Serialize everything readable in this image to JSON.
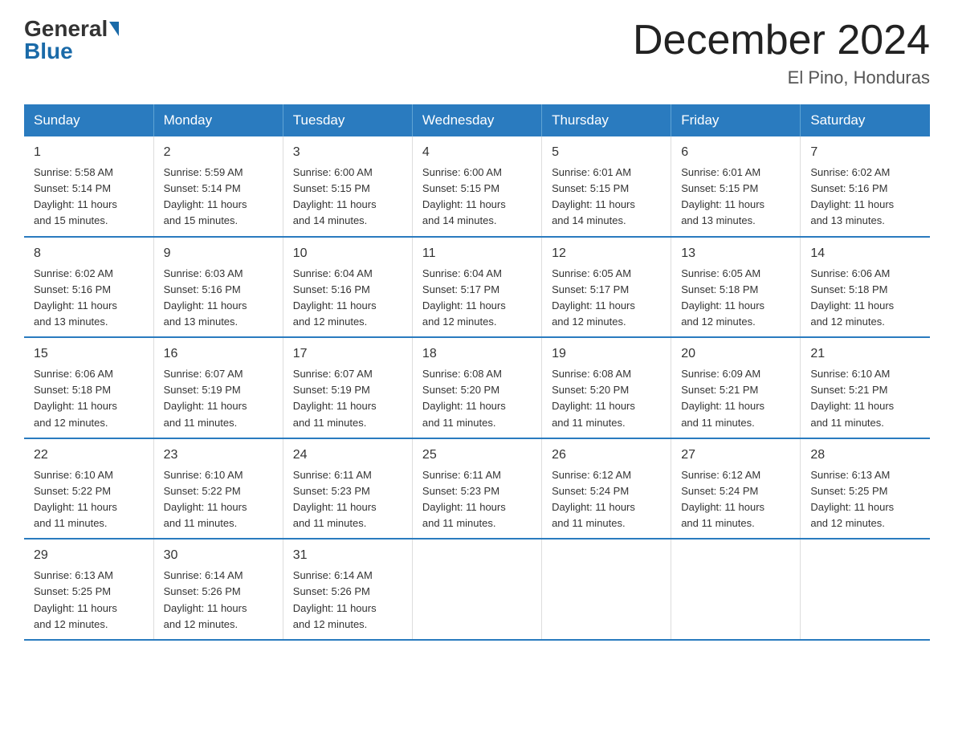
{
  "header": {
    "logo": {
      "general": "General",
      "blue": "Blue"
    },
    "title": "December 2024",
    "location": "El Pino, Honduras"
  },
  "weekdays": [
    "Sunday",
    "Monday",
    "Tuesday",
    "Wednesday",
    "Thursday",
    "Friday",
    "Saturday"
  ],
  "weeks": [
    [
      {
        "day": "1",
        "sunrise": "5:58 AM",
        "sunset": "5:14 PM",
        "daylight": "11 hours and 15 minutes."
      },
      {
        "day": "2",
        "sunrise": "5:59 AM",
        "sunset": "5:14 PM",
        "daylight": "11 hours and 15 minutes."
      },
      {
        "day": "3",
        "sunrise": "6:00 AM",
        "sunset": "5:15 PM",
        "daylight": "11 hours and 14 minutes."
      },
      {
        "day": "4",
        "sunrise": "6:00 AM",
        "sunset": "5:15 PM",
        "daylight": "11 hours and 14 minutes."
      },
      {
        "day": "5",
        "sunrise": "6:01 AM",
        "sunset": "5:15 PM",
        "daylight": "11 hours and 14 minutes."
      },
      {
        "day": "6",
        "sunrise": "6:01 AM",
        "sunset": "5:15 PM",
        "daylight": "11 hours and 13 minutes."
      },
      {
        "day": "7",
        "sunrise": "6:02 AM",
        "sunset": "5:16 PM",
        "daylight": "11 hours and 13 minutes."
      }
    ],
    [
      {
        "day": "8",
        "sunrise": "6:02 AM",
        "sunset": "5:16 PM",
        "daylight": "11 hours and 13 minutes."
      },
      {
        "day": "9",
        "sunrise": "6:03 AM",
        "sunset": "5:16 PM",
        "daylight": "11 hours and 13 minutes."
      },
      {
        "day": "10",
        "sunrise": "6:04 AM",
        "sunset": "5:16 PM",
        "daylight": "11 hours and 12 minutes."
      },
      {
        "day": "11",
        "sunrise": "6:04 AM",
        "sunset": "5:17 PM",
        "daylight": "11 hours and 12 minutes."
      },
      {
        "day": "12",
        "sunrise": "6:05 AM",
        "sunset": "5:17 PM",
        "daylight": "11 hours and 12 minutes."
      },
      {
        "day": "13",
        "sunrise": "6:05 AM",
        "sunset": "5:18 PM",
        "daylight": "11 hours and 12 minutes."
      },
      {
        "day": "14",
        "sunrise": "6:06 AM",
        "sunset": "5:18 PM",
        "daylight": "11 hours and 12 minutes."
      }
    ],
    [
      {
        "day": "15",
        "sunrise": "6:06 AM",
        "sunset": "5:18 PM",
        "daylight": "11 hours and 12 minutes."
      },
      {
        "day": "16",
        "sunrise": "6:07 AM",
        "sunset": "5:19 PM",
        "daylight": "11 hours and 11 minutes."
      },
      {
        "day": "17",
        "sunrise": "6:07 AM",
        "sunset": "5:19 PM",
        "daylight": "11 hours and 11 minutes."
      },
      {
        "day": "18",
        "sunrise": "6:08 AM",
        "sunset": "5:20 PM",
        "daylight": "11 hours and 11 minutes."
      },
      {
        "day": "19",
        "sunrise": "6:08 AM",
        "sunset": "5:20 PM",
        "daylight": "11 hours and 11 minutes."
      },
      {
        "day": "20",
        "sunrise": "6:09 AM",
        "sunset": "5:21 PM",
        "daylight": "11 hours and 11 minutes."
      },
      {
        "day": "21",
        "sunrise": "6:10 AM",
        "sunset": "5:21 PM",
        "daylight": "11 hours and 11 minutes."
      }
    ],
    [
      {
        "day": "22",
        "sunrise": "6:10 AM",
        "sunset": "5:22 PM",
        "daylight": "11 hours and 11 minutes."
      },
      {
        "day": "23",
        "sunrise": "6:10 AM",
        "sunset": "5:22 PM",
        "daylight": "11 hours and 11 minutes."
      },
      {
        "day": "24",
        "sunrise": "6:11 AM",
        "sunset": "5:23 PM",
        "daylight": "11 hours and 11 minutes."
      },
      {
        "day": "25",
        "sunrise": "6:11 AM",
        "sunset": "5:23 PM",
        "daylight": "11 hours and 11 minutes."
      },
      {
        "day": "26",
        "sunrise": "6:12 AM",
        "sunset": "5:24 PM",
        "daylight": "11 hours and 11 minutes."
      },
      {
        "day": "27",
        "sunrise": "6:12 AM",
        "sunset": "5:24 PM",
        "daylight": "11 hours and 11 minutes."
      },
      {
        "day": "28",
        "sunrise": "6:13 AM",
        "sunset": "5:25 PM",
        "daylight": "11 hours and 12 minutes."
      }
    ],
    [
      {
        "day": "29",
        "sunrise": "6:13 AM",
        "sunset": "5:25 PM",
        "daylight": "11 hours and 12 minutes."
      },
      {
        "day": "30",
        "sunrise": "6:14 AM",
        "sunset": "5:26 PM",
        "daylight": "11 hours and 12 minutes."
      },
      {
        "day": "31",
        "sunrise": "6:14 AM",
        "sunset": "5:26 PM",
        "daylight": "11 hours and 12 minutes."
      },
      null,
      null,
      null,
      null
    ]
  ],
  "labels": {
    "sunrise": "Sunrise:",
    "sunset": "Sunset:",
    "daylight": "Daylight:"
  }
}
